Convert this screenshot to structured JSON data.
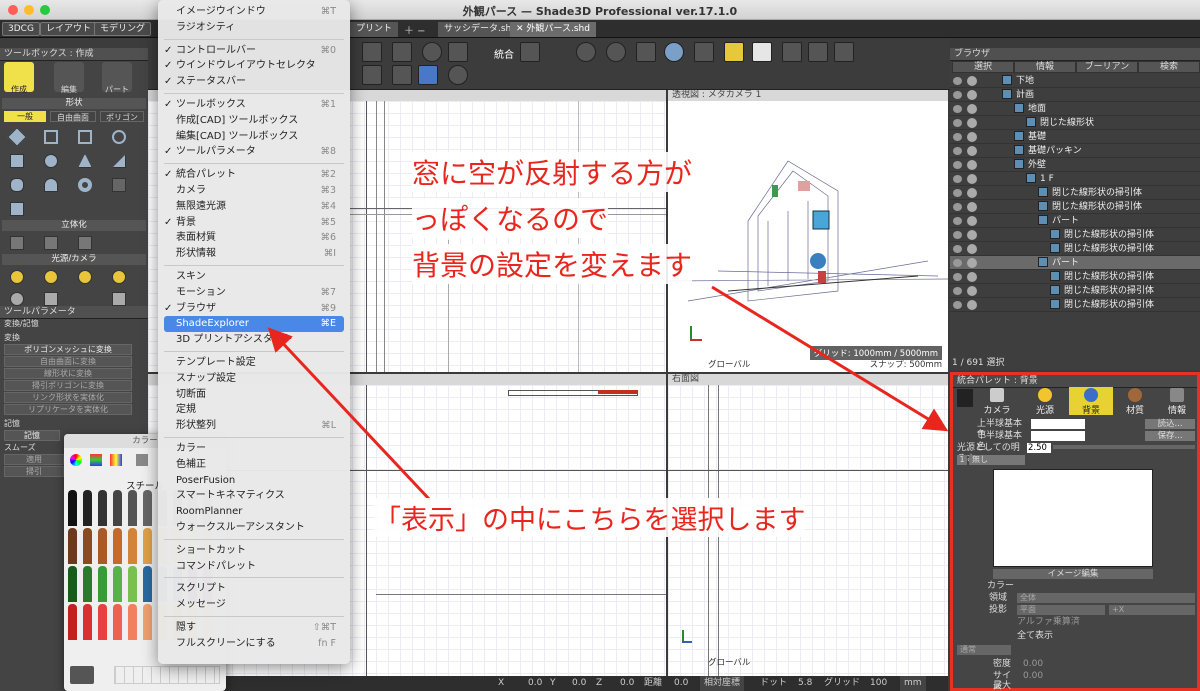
{
  "window": {
    "title": "外観パース — Shade3D Professional ver.17.1.0"
  },
  "mode_tabs": [
    "3DCG",
    "レイアウト",
    "モデリング"
  ],
  "doc_tabs": [
    "プリント",
    "サッシデータ.shd",
    "✕ 外観パース.shd"
  ],
  "toolbar": {
    "integrate_label": "統合"
  },
  "toolbox": {
    "header": "ツールボックス : 作成",
    "tools": [
      "作成",
      "編集",
      "パート"
    ],
    "shape_section": "形状",
    "shape_tabs": [
      "一般",
      "自由曲面",
      "ポリゴン"
    ],
    "solid_section": "立体化",
    "light_section": "光源/カメラ"
  },
  "tool_params": {
    "header": "ツールパラメータ",
    "subheader": "変換/記憶",
    "convert_label": "変換",
    "buttons": [
      "ポリゴンメッシュに変換",
      "自由曲面に変換",
      "線形状に変換",
      "掃引ポリゴンに変換",
      "リンク形状を実体化",
      "リプリケータを実体化"
    ],
    "memory_label": "記憶",
    "memory_items": [
      "記憶",
      "スムーズ",
      "適用",
      "掃引"
    ]
  },
  "view_menu": {
    "items": [
      {
        "label": "イメージウインドウ",
        "shortcut": "⌘T",
        "checked": false
      },
      {
        "label": "ラジオシティ",
        "shortcut": "",
        "checked": false
      },
      {
        "sep": true
      },
      {
        "label": "コントロールバー",
        "shortcut": "⌘0",
        "checked": true
      },
      {
        "label": "ウインドウレイアウトセレクタ",
        "shortcut": "",
        "checked": true
      },
      {
        "label": "ステータスバー",
        "shortcut": "",
        "checked": true
      },
      {
        "sep": true
      },
      {
        "label": "ツールボックス",
        "shortcut": "⌘1",
        "checked": true
      },
      {
        "label": "作成[CAD] ツールボックス",
        "shortcut": "",
        "checked": false
      },
      {
        "label": "編集[CAD] ツールボックス",
        "shortcut": "",
        "checked": false
      },
      {
        "label": "ツールパラメータ",
        "shortcut": "⌘8",
        "checked": true
      },
      {
        "sep": true
      },
      {
        "label": "統合パレット",
        "shortcut": "⌘2",
        "checked": true
      },
      {
        "label": "カメラ",
        "shortcut": "⌘3",
        "checked": false
      },
      {
        "label": "無限遠光源",
        "shortcut": "⌘4",
        "checked": false
      },
      {
        "label": "背景",
        "shortcut": "⌘5",
        "checked": true
      },
      {
        "label": "表面材質",
        "shortcut": "⌘6",
        "checked": false
      },
      {
        "label": "形状情報",
        "shortcut": "⌘I",
        "checked": false
      },
      {
        "sep": true
      },
      {
        "label": "スキン",
        "shortcut": "",
        "checked": false
      },
      {
        "label": "モーション",
        "shortcut": "⌘7",
        "checked": false
      },
      {
        "label": "ブラウザ",
        "shortcut": "⌘9",
        "checked": true
      },
      {
        "label": "ShadeExplorer",
        "shortcut": "⌘E",
        "checked": false,
        "highlight": true
      },
      {
        "label": "3D プリントアシスタント",
        "shortcut": "",
        "checked": false
      },
      {
        "sep": true
      },
      {
        "label": "テンプレート設定",
        "shortcut": "",
        "checked": false
      },
      {
        "label": "スナップ設定",
        "shortcut": "",
        "checked": false
      },
      {
        "label": "切断面",
        "shortcut": "",
        "checked": false
      },
      {
        "label": "定規",
        "shortcut": "",
        "checked": false
      },
      {
        "label": "形状整列",
        "shortcut": "⌘L",
        "checked": false
      },
      {
        "sep": true
      },
      {
        "label": "カラー",
        "shortcut": "",
        "checked": false
      },
      {
        "label": "色補正",
        "shortcut": "",
        "checked": false
      },
      {
        "label": "PoserFusion",
        "shortcut": "",
        "checked": false
      },
      {
        "label": "スマートキネマティクス",
        "shortcut": "",
        "checked": false
      },
      {
        "label": "RoomPlanner",
        "shortcut": "",
        "checked": false
      },
      {
        "label": "ウォークスルーアシスタント",
        "shortcut": "",
        "checked": false
      },
      {
        "sep": true
      },
      {
        "label": "ショートカット",
        "shortcut": "",
        "checked": false
      },
      {
        "label": "コマンドパレット",
        "shortcut": "",
        "checked": false
      },
      {
        "sep": true
      },
      {
        "label": "スクリプト",
        "shortcut": "",
        "checked": false
      },
      {
        "label": "メッセージ",
        "shortcut": "",
        "checked": false
      },
      {
        "sep": true
      },
      {
        "label": "隠す",
        "shortcut": "⇧⌘T",
        "checked": false
      },
      {
        "label": "フルスクリーンにする",
        "shortcut": "fn F",
        "checked": false
      }
    ]
  },
  "color_window": {
    "title": "カラー",
    "tab": "スチール"
  },
  "viewports": {
    "persp_label": "透視図 : メタカメラ 1",
    "right_label": "右面図",
    "grid_info": "グリッド: 1000mm / 5000mm",
    "snap_info": "スナップ: 500mm",
    "global_label": "グローバル",
    "global_label2": "グローバル"
  },
  "browser": {
    "header": "ブラウザ",
    "tabs": [
      "選択",
      "情報",
      "ブーリアン",
      "検索"
    ],
    "tree": [
      {
        "label": "下地",
        "indent": 1
      },
      {
        "label": "計画",
        "indent": 1
      },
      {
        "label": "地面",
        "indent": 2
      },
      {
        "label": "閉じた線形状",
        "indent": 3
      },
      {
        "label": "基礎",
        "indent": 2
      },
      {
        "label": "基礎パッキン",
        "indent": 2
      },
      {
        "label": "外壁",
        "indent": 2
      },
      {
        "label": "1 F",
        "indent": 3
      },
      {
        "label": "閉じた線形状の掃引体",
        "indent": 4
      },
      {
        "label": "閉じた線形状の掃引体",
        "indent": 4
      },
      {
        "label": "パート",
        "indent": 4
      },
      {
        "label": "閉じた線形状の掃引体",
        "indent": 5
      },
      {
        "label": "閉じた線形状の掃引体",
        "indent": 5
      },
      {
        "label": "パート",
        "indent": 4,
        "selected": true
      },
      {
        "label": "閉じた線形状の掃引体",
        "indent": 5
      },
      {
        "label": "閉じた線形状の掃引体",
        "indent": 5
      },
      {
        "label": "閉じた線形状の掃引体",
        "indent": 5
      }
    ],
    "status": "1 / 691 選択"
  },
  "palette": {
    "header": "統合パレット : 背景",
    "tabs": [
      "カメラ",
      "光源",
      "背景",
      "材質",
      "情報"
    ],
    "upper_label": "上半球基本色",
    "lower_label": "下半球基本色",
    "load_button": "読込...",
    "save_button": "保存...",
    "brightness_label": "光源としての明るさ",
    "brightness_value": "2.50",
    "layer_num": "1",
    "layer_none": "無し",
    "image_edit": "イメージ編集",
    "color_label": "カラー",
    "area_label": "領域",
    "area_value": "全体",
    "projection_label": "投影",
    "projection_value": "平面",
    "axis_value": "+X",
    "alpha_label": "アルファ乗算済",
    "all_display": "全て表示",
    "normal_label": "通常",
    "density_label": "密度",
    "size_label": "サイズ",
    "offset_label": "最大値",
    "zero": "0.00"
  },
  "statusbar": {
    "x_label": "X",
    "x_val": "0.0",
    "y_label": "Y",
    "y_val": "0.0",
    "z_label": "Z",
    "z_val": "0.0",
    "dist_label": "距離",
    "dist_val": "0.0",
    "coord": "相対座標",
    "dot_label": "ドット",
    "dot_val": "5.8",
    "grid_label": "グリッド",
    "grid_val": "100",
    "unit": "mm"
  },
  "annotations": {
    "line1": "窓に空が反射する方が",
    "line2": "っぽくなるので",
    "line3": "背景の設定を変えます",
    "instruction": "「表示」の中にこちらを選択します",
    "color": "#e8261e"
  }
}
